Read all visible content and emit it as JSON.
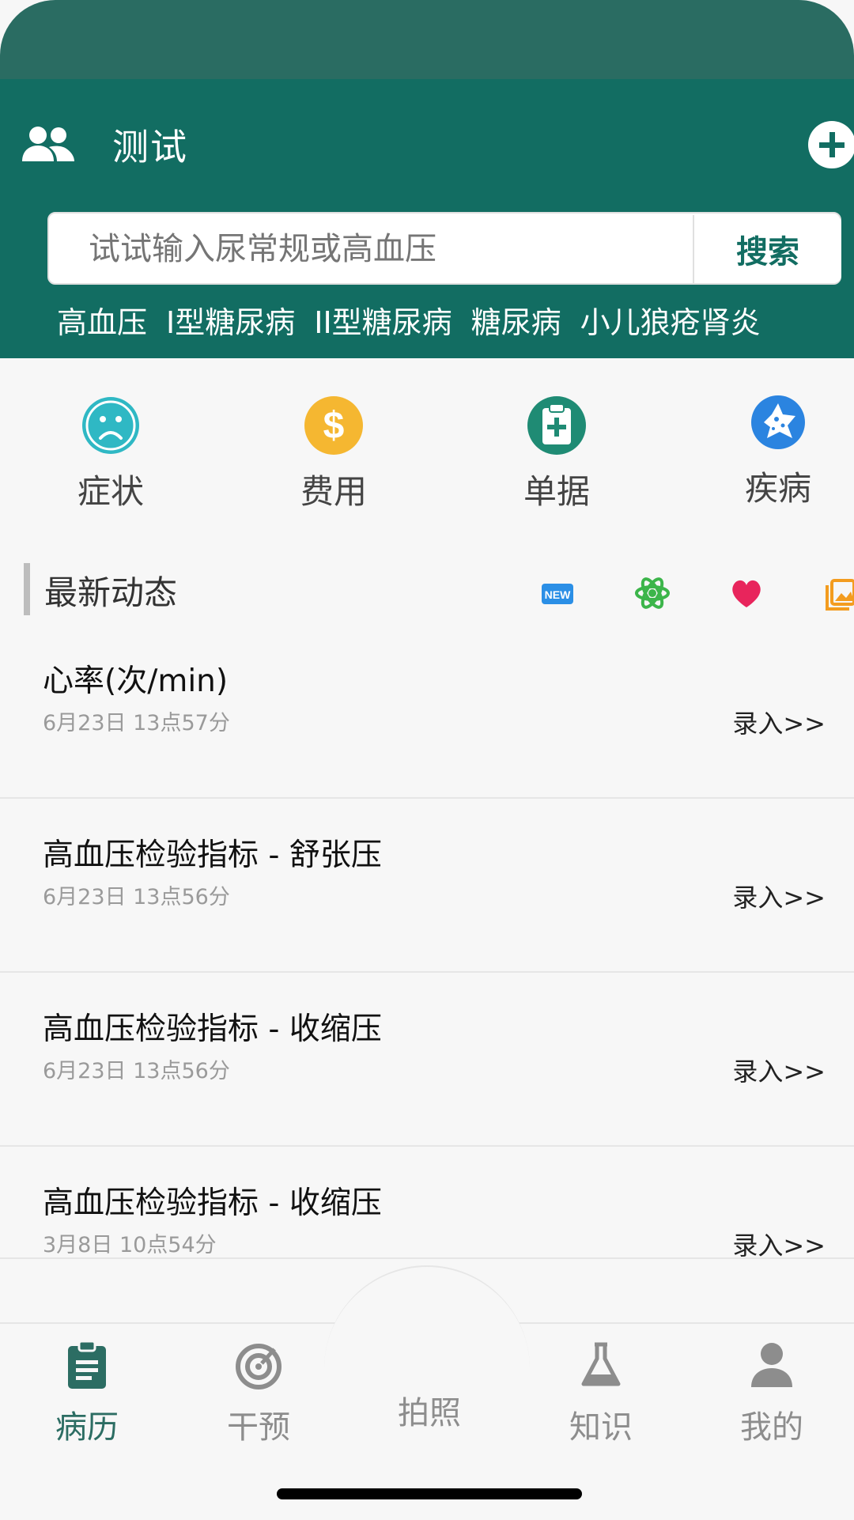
{
  "header": {
    "title": "测试"
  },
  "search": {
    "placeholder": "试试输入尿常规或高血压",
    "button_label": "搜索"
  },
  "quick_tags": [
    "高血压",
    "I型糖尿病",
    "II型糖尿病",
    "糖尿病",
    "小儿狼疮肾炎"
  ],
  "categories": [
    {
      "label": "症状",
      "icon": "sad-face-icon",
      "color": "#2fb8c4"
    },
    {
      "label": "费用",
      "icon": "dollar-icon",
      "color": "#f5b731"
    },
    {
      "label": "单据",
      "icon": "clipboard-plus-icon",
      "color": "#1f8b74"
    },
    {
      "label": "疾病",
      "icon": "virus-icon",
      "color": "#2b84e0"
    }
  ],
  "section": {
    "title": "最新动态",
    "icons": [
      "new-badge-icon",
      "atom-icon",
      "heart-icon",
      "gallery-icon"
    ],
    "new_badge": "NEW"
  },
  "feed": [
    {
      "title": "心率(次/min)",
      "time": "6月23日 13点57分",
      "action": "录入>>"
    },
    {
      "title": "高血压检验指标 - 舒张压",
      "time": "6月23日 13点56分",
      "action": "录入>>"
    },
    {
      "title": "高血压检验指标 - 收缩压",
      "time": "6月23日 13点56分",
      "action": "录入>>"
    },
    {
      "title": "高血压检验指标 - 收缩压",
      "time": "3月8日 10点54分",
      "action": "录入>>"
    }
  ],
  "tabs": [
    {
      "label": "病历",
      "icon": "clipboard-icon",
      "active": true
    },
    {
      "label": "干预",
      "icon": "target-icon",
      "active": false
    },
    {
      "label": "拍照",
      "icon": "camera-aperture-icon",
      "active": false
    },
    {
      "label": "知识",
      "icon": "flask-icon",
      "active": false
    },
    {
      "label": "我的",
      "icon": "person-icon",
      "active": false
    }
  ],
  "colors": {
    "primary": "#126d62",
    "status": "#2a6c62",
    "accent_teal": "#2a7d70"
  }
}
